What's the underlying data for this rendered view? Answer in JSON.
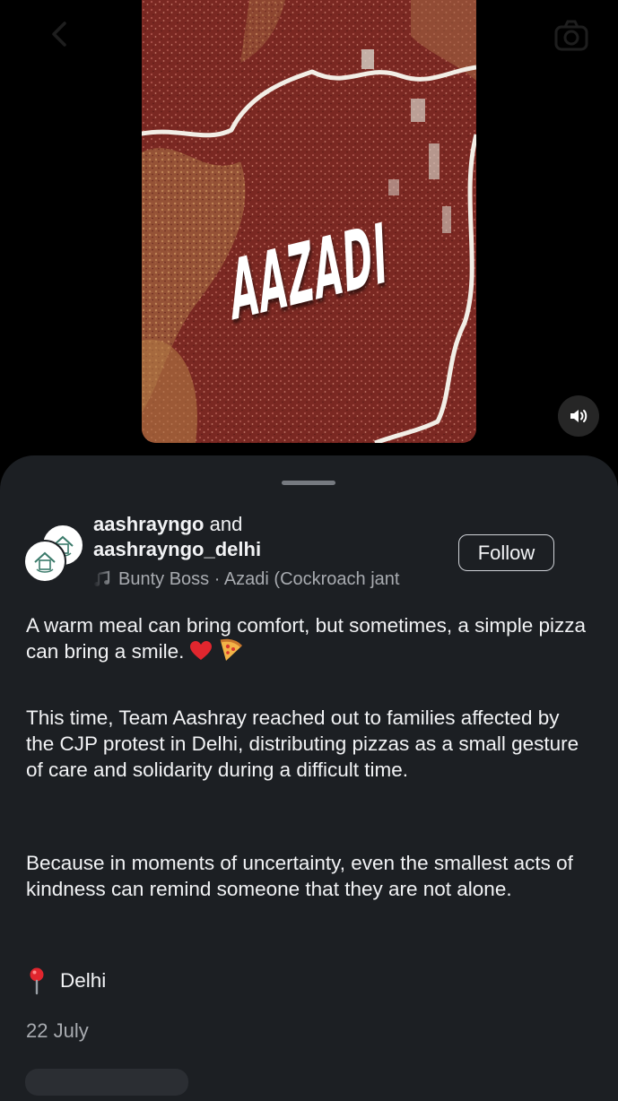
{
  "top_bar": {
    "back_icon": "chevron-left-icon",
    "camera_icon": "camera-icon"
  },
  "reel": {
    "title": "AAZADI",
    "mute_icon": "speaker-icon"
  },
  "post": {
    "author_1": "aashrayngo",
    "author_connector": "and",
    "author_2": "aashrayngo_delhi",
    "music_text": "Bunty Boss · Azadi (Cockroach jant",
    "follow_label": "Follow",
    "caption": [
      "A warm meal can bring comfort, but sometimes, a simple pizza can bring a smile.",
      "This time, Team Aashray reached out to families affected by the CJP protest in Delhi, distributing pizzas as a small gesture of care and solidarity during a difficult time.",
      "Because in moments of uncertainty, even the smallest acts of kindness can remind someone that they are not alone."
    ],
    "caption_emojis": [
      "heart-emoji",
      "pizza-emoji"
    ],
    "location": "Delhi",
    "date": "22 July"
  },
  "colors": {
    "sheet_bg": "#1c1f23",
    "text": "#f2f3f5",
    "muted": "#a8abb0",
    "reel_red": "#7d2a23"
  }
}
